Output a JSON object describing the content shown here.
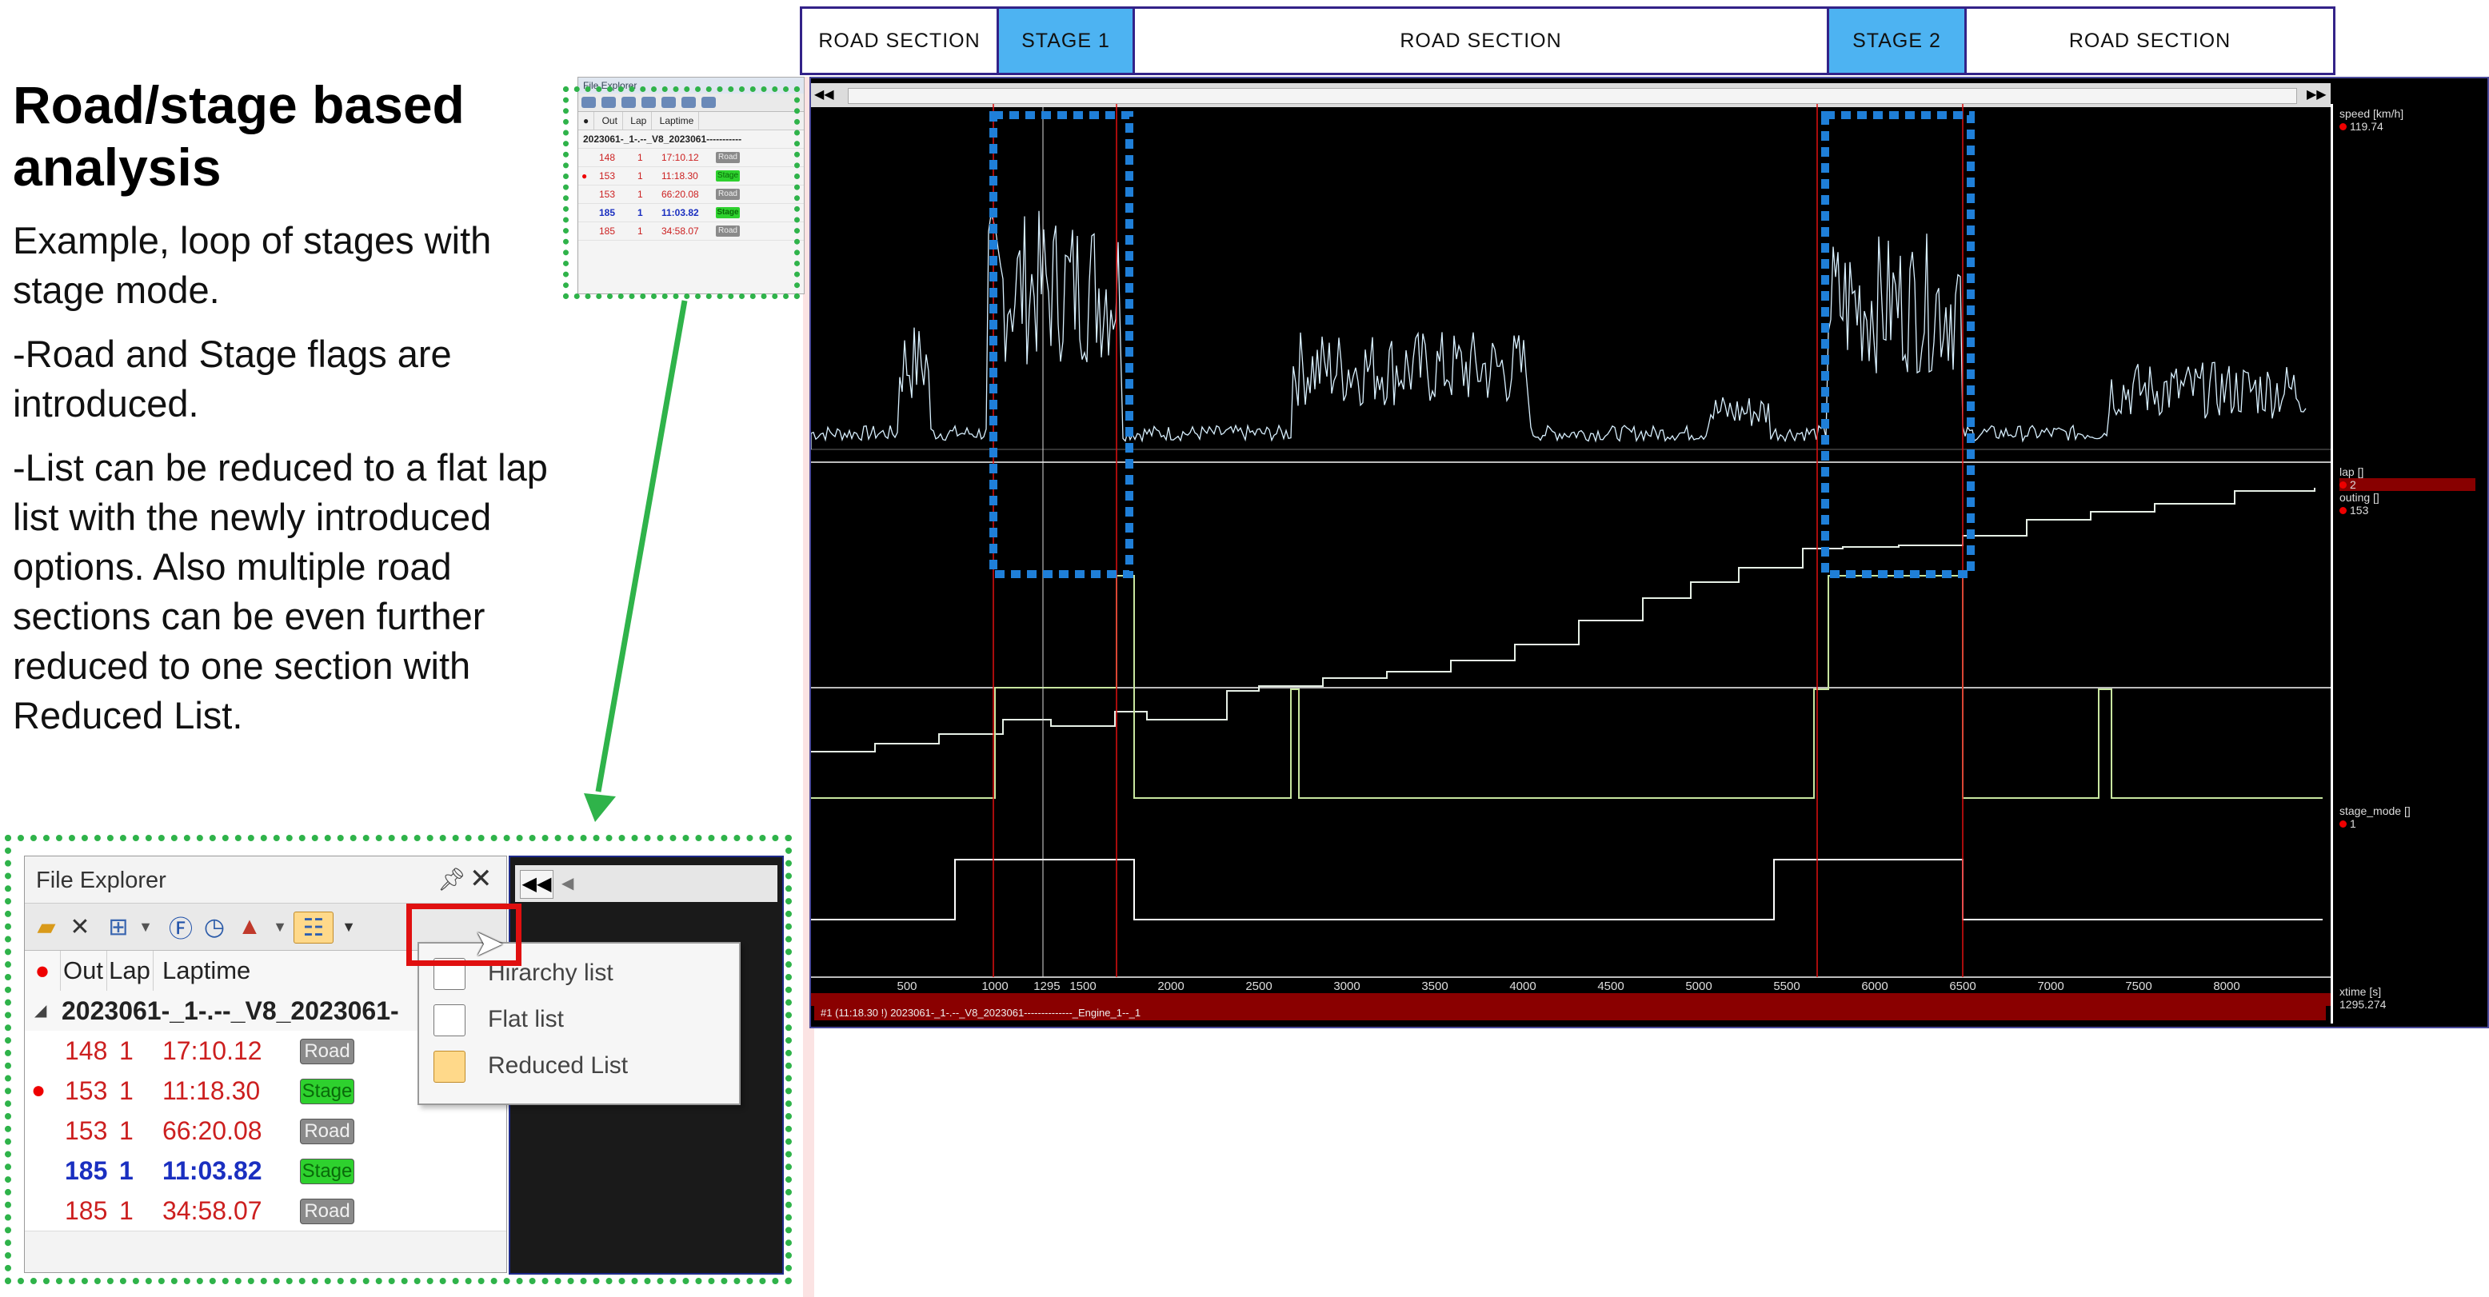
{
  "slide": {
    "heading": "Road/stage based analysis",
    "paragraphs": [
      "Example, loop of stages with stage mode.",
      "-Road and Stage flags are introduced.",
      "-List can be reduced to a flat lap list with the newly introduced options. Also multiple road sections can be even further reduced to one section with Reduced List."
    ]
  },
  "section_bar": {
    "items": [
      {
        "label": "ROAD SECTION",
        "kind": "road"
      },
      {
        "label": "STAGE 1",
        "kind": "stage"
      },
      {
        "label": "ROAD SECTION",
        "kind": "road"
      },
      {
        "label": "STAGE 2",
        "kind": "stage"
      },
      {
        "label": "ROAD SECTION",
        "kind": "road"
      }
    ]
  },
  "file_explorer": {
    "title": "File Explorer",
    "pin_icon": "pin-icon",
    "close_icon": "close-icon",
    "columns": [
      "Out",
      "Lap",
      "Laptime"
    ],
    "group_label": "2023061-_1-.--_V8_2023061-",
    "rows": [
      {
        "out": "148",
        "lap": "1",
        "laptime": "17:10.12",
        "flag": "Road",
        "marked": false,
        "bold": false,
        "color": "#cc1f1f"
      },
      {
        "out": "153",
        "lap": "1",
        "laptime": "11:18.30",
        "flag": "Stage",
        "marked": true,
        "bold": false,
        "color": "#cc1f1f"
      },
      {
        "out": "153",
        "lap": "1",
        "laptime": "66:20.08",
        "flag": "Road",
        "marked": false,
        "bold": false,
        "color": "#cc1f1f"
      },
      {
        "out": "185",
        "lap": "1",
        "laptime": "11:03.82",
        "flag": "Stage",
        "marked": false,
        "bold": true,
        "color": "#1a2fc0"
      },
      {
        "out": "185",
        "lap": "1",
        "laptime": "34:58.07",
        "flag": "Road",
        "marked": false,
        "bold": false,
        "color": "#cc1f1f"
      }
    ],
    "dropdown_options": [
      "Hirarchy list",
      "Flat list",
      "Reduced List"
    ]
  },
  "thumbnail": {
    "title": "File Explorer",
    "columns": [
      "Out",
      "Lap",
      "Laptime"
    ],
    "group_label": "2023061-_1-.--_V8_2023061-----------"
  },
  "telemetry": {
    "channels": [
      {
        "name": "speed [km/h]",
        "value": "119.74"
      },
      {
        "name": "lap []",
        "value": "2"
      },
      {
        "name": "outing []",
        "value": "153"
      },
      {
        "name": "stage_mode []",
        "value": "1"
      },
      {
        "name": "xtime [s]",
        "value": "1295.274"
      }
    ],
    "axis_ticks": [
      "500",
      "1000",
      "1295",
      "1500",
      "2000",
      "2500",
      "3000",
      "3500",
      "4000",
      "4500",
      "5000",
      "5500",
      "6000",
      "6500",
      "7000",
      "7500",
      "8000"
    ],
    "status_line": "#1 (11:18.30 !) 2023061-_1-.--_V8_2023061--------------_Engine_1--_1",
    "colors": {
      "trace": "#d8f0ff",
      "marker": "#e01010",
      "stage_box": "#1f7fd8",
      "steps": "#c8e6a0"
    }
  }
}
